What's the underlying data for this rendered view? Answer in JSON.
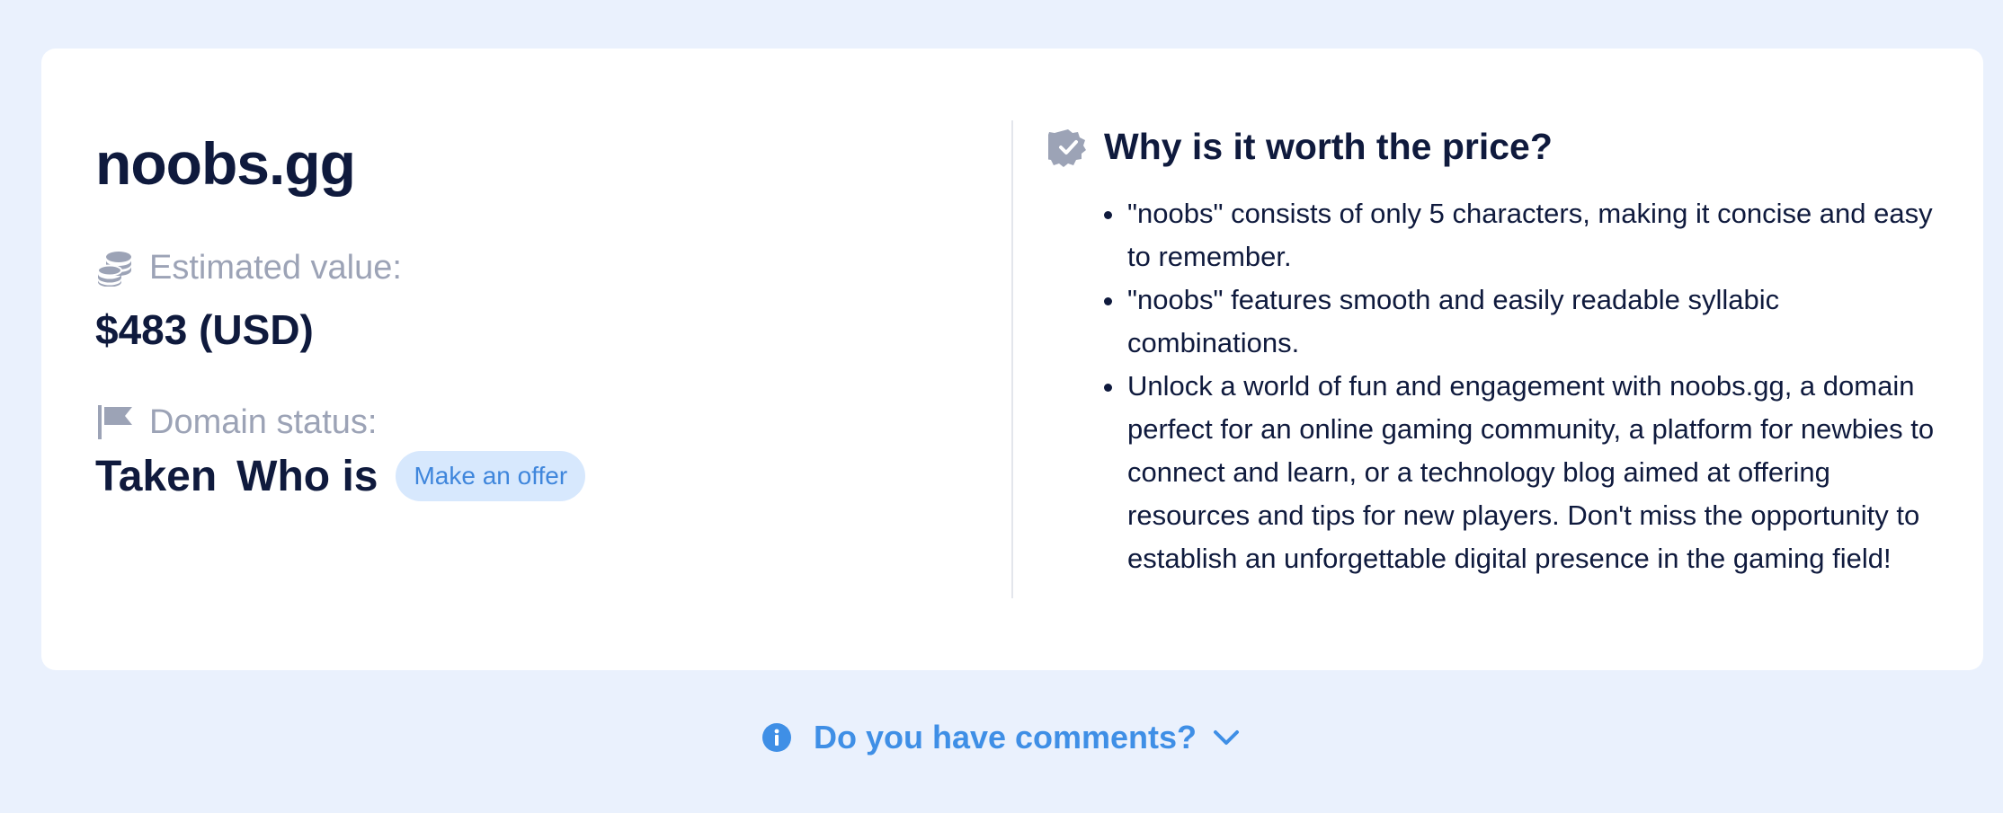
{
  "domain": {
    "name": "noobs.gg"
  },
  "estimated_value": {
    "label": "Estimated value:",
    "value": "$483 (USD)",
    "icon": "coins-icon"
  },
  "domain_status": {
    "label": "Domain status:",
    "status": "Taken",
    "whois_label": "Who is",
    "offer_label": "Make an offer",
    "icon": "flag-icon"
  },
  "why": {
    "title": "Why is it worth the price?",
    "icon": "verified-badge-icon",
    "reasons": [
      "\"noobs\" consists of only 5 characters, making it concise and easy to remember.",
      "\"noobs\" features smooth and easily readable syllabic combinations.",
      "Unlock a world of fun and engagement with noobs.gg, a domain perfect for an online gaming community, a platform for newbies to connect and learn, or a technology blog aimed at offering resources and tips for new players. Don't miss the opportunity to establish an unforgettable digital presence in the gaming field!"
    ]
  },
  "comments": {
    "label": "Do you have comments?",
    "icon": "info-icon",
    "toggle_icon": "chevron-down-icon"
  },
  "colors": {
    "background": "#eaf1fd",
    "card": "#ffffff",
    "text_primary": "#0f1a3d",
    "text_muted": "#9ca3b6",
    "accent": "#3f8fe6",
    "offer_bg": "#d7e8fd"
  }
}
